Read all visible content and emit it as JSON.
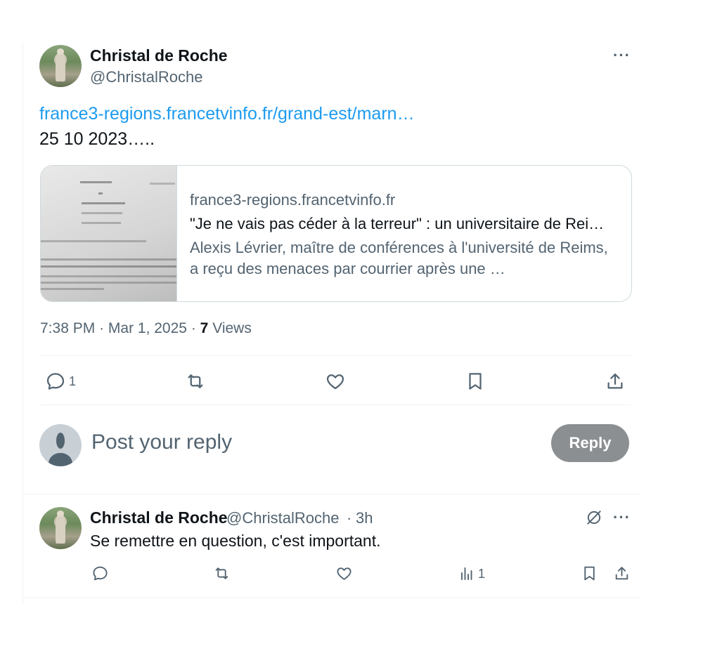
{
  "main_post": {
    "author_name": "Christal de Roche",
    "author_handle": "@ChristalRoche",
    "link": "france3-regions.francetvinfo.fr/grand-est/marn…",
    "text": "25 10 2023…..",
    "card": {
      "domain": "france3-regions.francetvinfo.fr",
      "title": "\"Je ne vais pas céder à la terreur\" : un universitaire de Rei…",
      "description": "Alexis Lévrier, maître de conférences à l'université de Reims, a reçu des menaces par courrier après une …",
      "thumbnail_icon": "document-letter-photo"
    },
    "time": "7:38 PM",
    "date": "Mar 1, 2025",
    "views_count": "7",
    "views_label": "Views",
    "actions": {
      "reply_count": "1"
    }
  },
  "reply_box": {
    "placeholder": "Post your reply",
    "button_label": "Reply"
  },
  "reply_post": {
    "author_name": "Christal de Roche",
    "author_handle": "@ChristalRoche",
    "dot": "·",
    "time": "3h",
    "text": "Se remettre en question, c'est important.",
    "views_count": "1"
  },
  "colors": {
    "accent": "#1d9bf0",
    "secondary_text": "#536471",
    "button_disabled": "#8b8f92"
  },
  "icons": [
    "more-icon",
    "reply-icon",
    "repost-icon",
    "like-icon",
    "bookmark-icon",
    "share-icon",
    "views-icon",
    "grok-icon"
  ]
}
